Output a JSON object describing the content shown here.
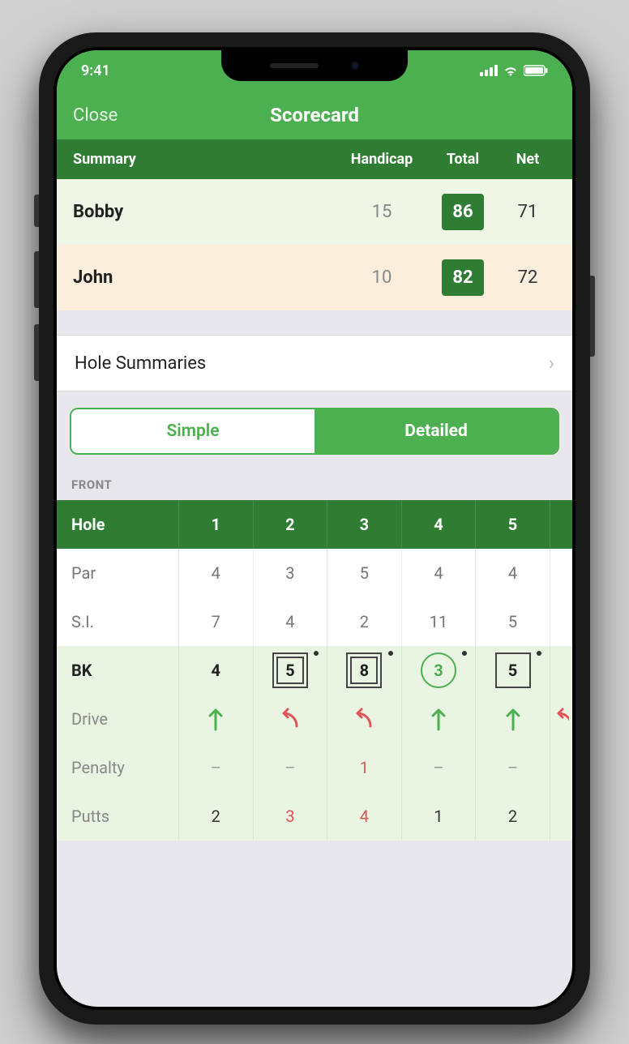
{
  "status": {
    "time": "9:41"
  },
  "nav": {
    "close": "Close",
    "title": "Scorecard"
  },
  "summary": {
    "header": {
      "label": "Summary",
      "handicap": "Handicap",
      "total": "Total",
      "net": "Net"
    },
    "players": [
      {
        "name": "Bobby",
        "handicap": "15",
        "total": "86",
        "net": "71"
      },
      {
        "name": "John",
        "handicap": "10",
        "total": "82",
        "net": "72"
      }
    ]
  },
  "holeSummaries": {
    "label": "Hole Summaries"
  },
  "toggle": {
    "simple": "Simple",
    "detailed": "Detailed"
  },
  "section": {
    "front": "FRONT"
  },
  "table": {
    "holeLabel": "Hole",
    "holes": [
      "1",
      "2",
      "3",
      "4",
      "5"
    ],
    "parLabel": "Par",
    "par": [
      "4",
      "3",
      "5",
      "4",
      "4"
    ],
    "siLabel": "S.I.",
    "si": [
      "7",
      "4",
      "2",
      "11",
      "5"
    ],
    "bkLabel": "BK",
    "bk": [
      "4",
      "5",
      "8",
      "3",
      "5"
    ],
    "driveLabel": "Drive",
    "penaltyLabel": "Penalty",
    "penalty": [
      "–",
      "–",
      "1",
      "–",
      "–"
    ],
    "puttsLabel": "Putts",
    "putts": [
      "2",
      "3",
      "4",
      "1",
      "2"
    ]
  }
}
